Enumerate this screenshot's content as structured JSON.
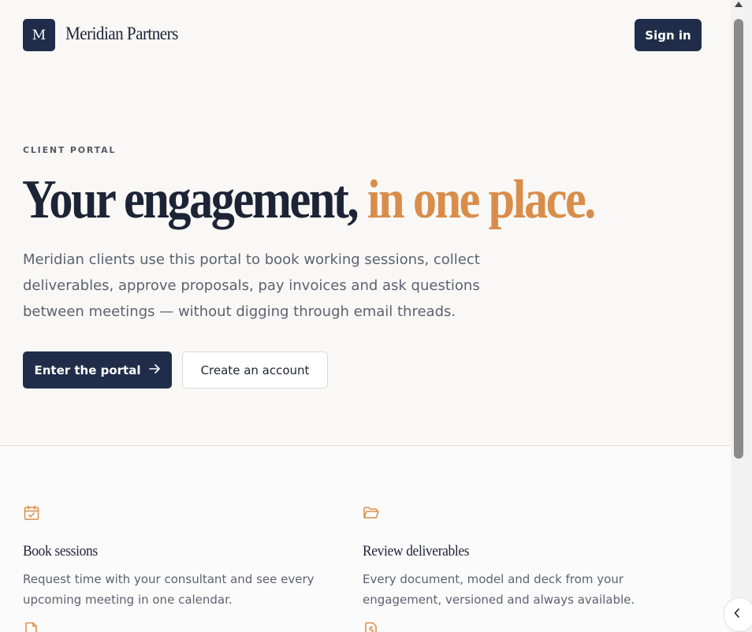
{
  "header": {
    "logo_letter": "M",
    "brand_name": "Meridian Partners",
    "sign_in_label": "Sign in"
  },
  "hero": {
    "eyebrow": "CLIENT PORTAL",
    "headline_main": "Your engagement, ",
    "headline_accent": "in one place.",
    "lede": "Meridian clients use this portal to book working sessions, collect deliverables, approve proposals, pay invoices and ask questions between meetings — without digging through email threads.",
    "primary_cta": "Enter the portal",
    "primary_cta_icon": "arrow-right-icon",
    "secondary_cta": "Create an account"
  },
  "features": [
    {
      "icon": "calendar-check-icon",
      "title": "Book sessions",
      "description": "Request time with your consultant and see every upcoming meeting in one calendar."
    },
    {
      "icon": "folder-open-icon",
      "title": "Review deliverables",
      "description": "Every document, model and deck from your engagement, versioned and always available."
    },
    {
      "icon": "document-icon",
      "title": "",
      "description": ""
    },
    {
      "icon": "invoice-dollar-icon",
      "title": "",
      "description": ""
    }
  ],
  "colors": {
    "navy": "#1f2d4a",
    "accent": "#d98d4a",
    "background": "#f9f8f6",
    "body_text": "#5c6270"
  }
}
